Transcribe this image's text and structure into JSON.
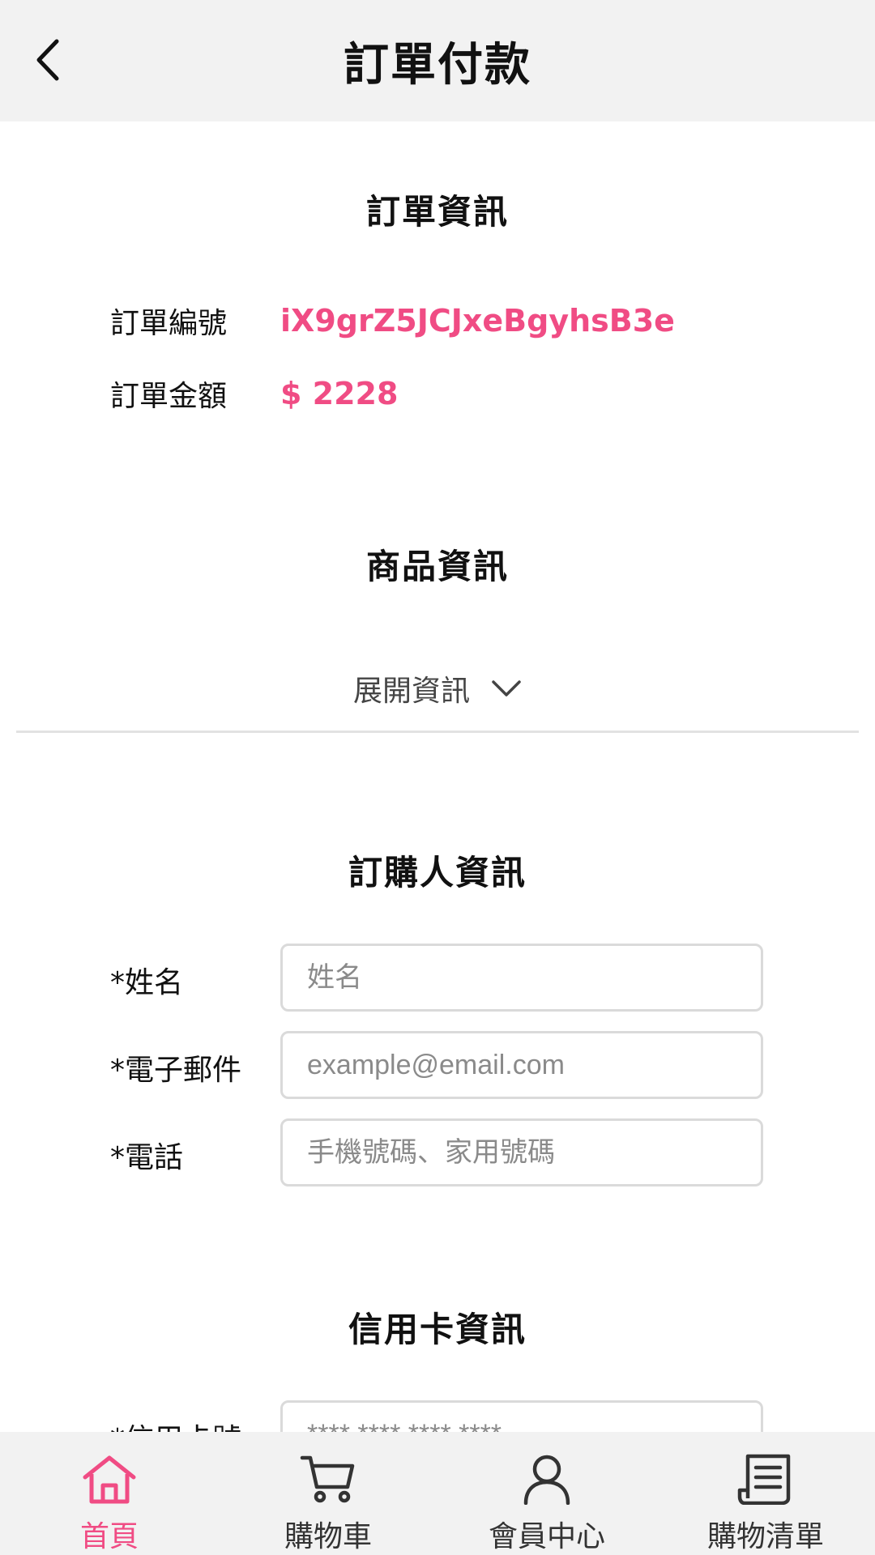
{
  "header": {
    "title": "訂單付款"
  },
  "order_info": {
    "title": "訂單資訊",
    "order_number_label": "訂單編號",
    "order_number": "iX9grZ5JCJxeBgyhsB3e",
    "amount_label": "訂單金額",
    "amount": "$ 2228"
  },
  "product_info": {
    "title": "商品資訊",
    "expand_label": "展開資訊"
  },
  "buyer_info": {
    "title": "訂購人資訊",
    "name_label": "*姓名",
    "name_placeholder": "姓名",
    "email_label": "*電子郵件",
    "email_placeholder": "example@email.com",
    "phone_label": "*電話",
    "phone_placeholder": "手機號碼、家用號碼"
  },
  "card_info": {
    "title": "信用卡資訊",
    "card_number_label": "*信用卡號",
    "card_number_placeholder": "**** **** **** ****"
  },
  "bottom_nav": {
    "items": [
      {
        "label": "首頁",
        "icon": "home-icon",
        "active": true
      },
      {
        "label": "購物車",
        "icon": "cart-icon",
        "active": false
      },
      {
        "label": "會員中心",
        "icon": "user-icon",
        "active": false
      },
      {
        "label": "購物清單",
        "icon": "list-icon",
        "active": false
      }
    ]
  },
  "colors": {
    "accent": "#f04c84",
    "header_bg": "#f2f2f2",
    "text": "#111111",
    "inactive_icon": "#333333"
  }
}
